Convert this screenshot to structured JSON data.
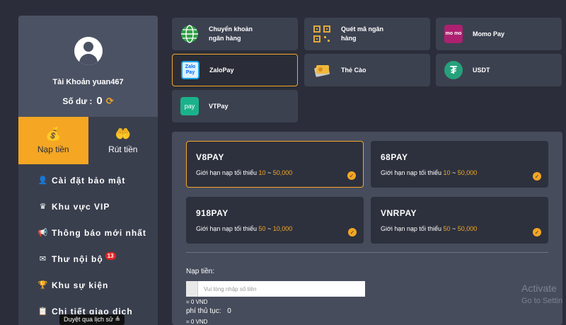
{
  "profile": {
    "account": "Tài Khoản yuan467",
    "balance_label": "Số dư :",
    "balance_value": "0"
  },
  "tabs": [
    {
      "label": "Nạp tiền",
      "icon": "money-bag-icon",
      "active": true
    },
    {
      "label": "Rút tiền",
      "icon": "withdraw-hand-icon",
      "active": false
    }
  ],
  "menu": [
    {
      "label": "Cài đặt bảo mật",
      "icon": "user-settings-icon"
    },
    {
      "label": "Khu vực VIP",
      "icon": "crown-icon"
    },
    {
      "label": "Thông báo mới nhất",
      "icon": "megaphone-icon"
    },
    {
      "label": "Thư nội bộ",
      "icon": "mail-icon",
      "badge": "13"
    },
    {
      "label": "Khu sự kiện",
      "icon": "trophy-icon"
    },
    {
      "label": "Chi tiết giao dịch",
      "icon": "clipboard-icon"
    }
  ],
  "tooltip": "Duyệt qua lịch sử ≜",
  "methods": [
    {
      "line1": "Chuyển khoản",
      "line2": "ngân hàng",
      "icon": "globe-icon"
    },
    {
      "line1": "Quét mã ngân",
      "line2": "hàng",
      "icon": "qr-code-icon"
    },
    {
      "line1": "Momo Pay",
      "line2": "",
      "icon": "momo-logo-icon",
      "logo_text": "mo mo"
    },
    {
      "line1": "ZaloPay",
      "line2": "",
      "icon": "zalopay-logo-icon",
      "logo_text": "Zalo Pay",
      "selected": true
    },
    {
      "line1": "Thẻ Cào",
      "line2": "",
      "icon": "card-icon"
    },
    {
      "line1": "USDT",
      "line2": "",
      "icon": "tether-icon",
      "logo_text": "₮"
    },
    {
      "line1": "VTPay",
      "line2": "",
      "icon": "vtpay-logo-icon",
      "logo_text": "pay"
    }
  ],
  "gateways": [
    {
      "name": "V8PAY",
      "limit_label": "Giới hạn nạp tối thiểu",
      "min": "10",
      "sep": " ~ ",
      "max": "50,000",
      "selected": true
    },
    {
      "name": "68PAY",
      "limit_label": "Giới hạn nạp tối thiểu",
      "min": "10",
      "sep": " ~ ",
      "max": "50,000"
    },
    {
      "name": "918PAY",
      "limit_label": "Giới hạn nạp tối thiểu",
      "min": "50",
      "sep": " ~ ",
      "max": "10,000"
    },
    {
      "name": "VNRPAY",
      "limit_label": "Giới hạn nạp tối thiểu",
      "min": "50",
      "sep": " ~ ",
      "max": "50,000"
    }
  ],
  "form": {
    "amount_label": "Nạp tiền:",
    "amount_placeholder": "Vui lòng nhập số tiền",
    "amount_vnd": "= 0 VND",
    "fee_label": "phí thủ tục:",
    "fee_value": "0",
    "fee_vnd": "= 0 VND"
  },
  "watermark": {
    "line1": "Activate",
    "line2": "Go to Settin"
  },
  "colors": {
    "accent": "#f5a623",
    "background": "#2b2e3a",
    "card": "#3c4150",
    "panel": "#474c5c"
  }
}
